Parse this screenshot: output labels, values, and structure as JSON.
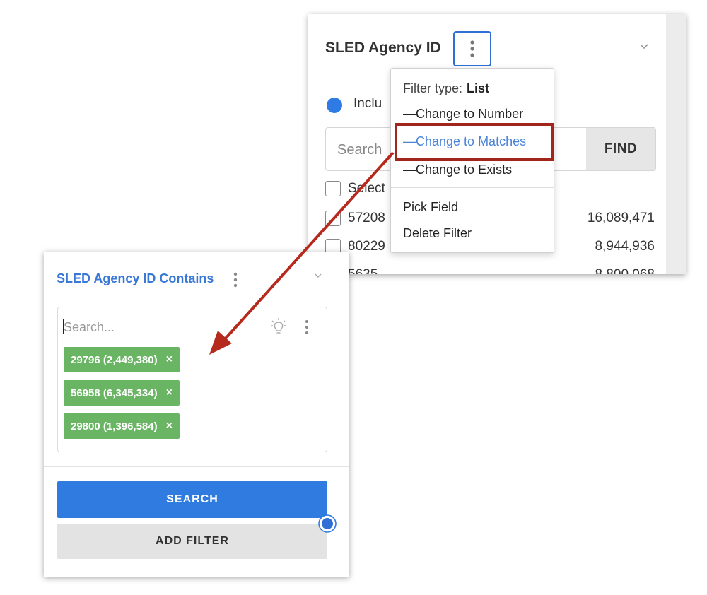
{
  "back_panel": {
    "title": "SLED Agency ID",
    "include_label": "Inclu",
    "search_placeholder": "Search",
    "find_label": "FIND",
    "select_label": "Select",
    "rows": [
      {
        "label": "57208",
        "count": "16,089,471"
      },
      {
        "label": "80229",
        "count": "8,944,936"
      },
      {
        "label": "5635",
        "count": "8,800,068"
      }
    ]
  },
  "menu": {
    "filter_type_label": "Filter type:",
    "filter_type_value": "List",
    "change_number": "—Change to Number",
    "change_matches": "—Change to Matches",
    "change_exists": "—Change to Exists",
    "pick_field": "Pick Field",
    "delete_filter": "Delete Filter"
  },
  "front_panel": {
    "title": "SLED Agency ID Contains",
    "search_placeholder": "Search...",
    "tags": [
      {
        "label": "29796 (2,449,380)",
        "remove": "×"
      },
      {
        "label": "56958 (6,345,334)",
        "remove": "×"
      },
      {
        "label": "29800 (1,396,584)",
        "remove": "×"
      }
    ],
    "search_button": "SEARCH",
    "add_filter_button": "ADD FILTER"
  },
  "colors": {
    "accent_blue": "#2f7be0",
    "title_blue": "#3a78d8",
    "tag_green": "#6ab564",
    "highlight_red": "#a1251b",
    "arrow_red": "#b62a1e"
  },
  "icons": {
    "kebab": "kebab-menu-icon",
    "chevron": "chevron-down-icon",
    "bulb": "lightbulb-icon",
    "remove": "close-icon"
  }
}
